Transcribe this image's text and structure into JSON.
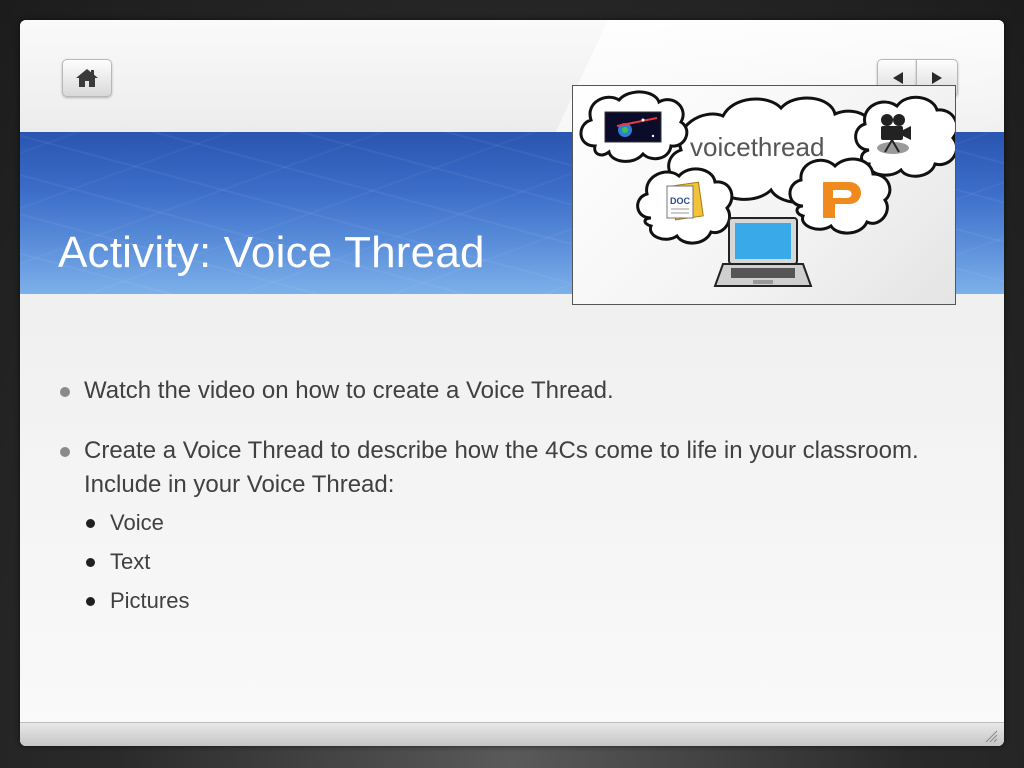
{
  "slide": {
    "title": "Activity: Voice Thread",
    "bullets": [
      {
        "text": "Watch the video on how to create a Voice Thread."
      },
      {
        "text": "Create a Voice Thread to describe how the 4Cs come to life in your classroom. Include in your Voice Thread:"
      }
    ],
    "sub_bullets": [
      "Voice",
      "Text",
      "Pictures"
    ]
  },
  "image": {
    "logo_text": "voicethread",
    "doc_label": "DOC"
  },
  "colors": {
    "band_top": "#2a55b0",
    "band_bottom": "#7db0ea",
    "title_text": "#ffffff",
    "body_text": "#404040"
  },
  "icons": {
    "home": "home-icon",
    "prev": "triangle-left-icon",
    "next": "triangle-right-icon"
  }
}
